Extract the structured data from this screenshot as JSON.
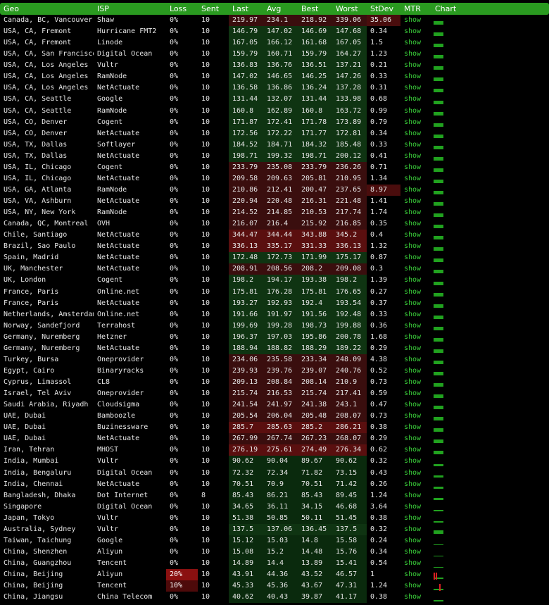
{
  "columns": [
    "Geo",
    "ISP",
    "Loss",
    "Sent",
    "Last",
    "Avg",
    "Best",
    "Worst",
    "StDev",
    "MTR",
    "Chart"
  ],
  "colors": {
    "header": "#2a9a20",
    "accent": "#3ad03a",
    "high": "#5a0f0f",
    "low": "#0f3412"
  },
  "rows": [
    {
      "geo": "Canada, BC, Vancouver",
      "isp": "Shaw",
      "loss": "0%",
      "sent": "10",
      "last": "219.97",
      "avg": "234.1",
      "best": "218.92",
      "worst": "339.06",
      "stdev": "35.06",
      "mtr": "show",
      "lv": "mid",
      "sdw": true,
      "chart": [
        {
          "h": 5
        }
      ]
    },
    {
      "geo": "USA, CA, Fremont",
      "isp": "Hurricane FMT2",
      "loss": "0%",
      "sent": "10",
      "last": "146.79",
      "avg": "147.02",
      "best": "146.69",
      "worst": "147.68",
      "stdev": "0.34",
      "mtr": "show",
      "lv": "low",
      "chart": [
        {
          "h": 5
        }
      ]
    },
    {
      "geo": "USA, CA, Fremont",
      "isp": "Linode",
      "loss": "0%",
      "sent": "10",
      "last": "167.05",
      "avg": "166.12",
      "best": "161.68",
      "worst": "167.05",
      "stdev": "1.5",
      "mtr": "show",
      "lv": "low",
      "chart": [
        {
          "h": 5
        }
      ]
    },
    {
      "geo": "USA, CA, San Francisco",
      "isp": "Digital Ocean",
      "loss": "0%",
      "sent": "10",
      "last": "159.79",
      "avg": "160.71",
      "best": "159.79",
      "worst": "164.27",
      "stdev": "1.23",
      "mtr": "show",
      "lv": "low",
      "chart": [
        {
          "h": 5
        }
      ]
    },
    {
      "geo": "USA, CA, Los Angeles",
      "isp": "Vultr",
      "loss": "0%",
      "sent": "10",
      "last": "136.83",
      "avg": "136.76",
      "best": "136.51",
      "worst": "137.21",
      "stdev": "0.21",
      "mtr": "show",
      "lv": "low",
      "chart": [
        {
          "h": 5
        }
      ]
    },
    {
      "geo": "USA, CA, Los Angeles",
      "isp": "RamNode",
      "loss": "0%",
      "sent": "10",
      "last": "147.02",
      "avg": "146.65",
      "best": "146.25",
      "worst": "147.26",
      "stdev": "0.33",
      "mtr": "show",
      "lv": "low",
      "chart": [
        {
          "h": 5
        }
      ]
    },
    {
      "geo": "USA, CA, Los Angeles",
      "isp": "NetActuate",
      "loss": "0%",
      "sent": "10",
      "last": "136.58",
      "avg": "136.86",
      "best": "136.24",
      "worst": "137.28",
      "stdev": "0.31",
      "mtr": "show",
      "lv": "low",
      "chart": [
        {
          "h": 5
        }
      ]
    },
    {
      "geo": "USA, CA, Seattle",
      "isp": "Google",
      "loss": "0%",
      "sent": "10",
      "last": "131.44",
      "avg": "132.07",
      "best": "131.44",
      "worst": "133.98",
      "stdev": "0.68",
      "mtr": "show",
      "lv": "low",
      "chart": [
        {
          "h": 5
        }
      ]
    },
    {
      "geo": "USA, CA, Seattle",
      "isp": "RamNode",
      "loss": "0%",
      "sent": "10",
      "last": "160.8",
      "avg": "162.89",
      "best": "160.8",
      "worst": "163.72",
      "stdev": "0.99",
      "mtr": "show",
      "lv": "low",
      "chart": [
        {
          "h": 5
        }
      ]
    },
    {
      "geo": "USA, CO, Denver",
      "isp": "Cogent",
      "loss": "0%",
      "sent": "10",
      "last": "171.87",
      "avg": "172.41",
      "best": "171.78",
      "worst": "173.89",
      "stdev": "0.79",
      "mtr": "show",
      "lv": "low",
      "chart": [
        {
          "h": 5
        }
      ]
    },
    {
      "geo": "USA, CO, Denver",
      "isp": "NetActuate",
      "loss": "0%",
      "sent": "10",
      "last": "172.56",
      "avg": "172.22",
      "best": "171.77",
      "worst": "172.81",
      "stdev": "0.34",
      "mtr": "show",
      "lv": "low",
      "chart": [
        {
          "h": 5
        }
      ]
    },
    {
      "geo": "USA, TX, Dallas",
      "isp": "Softlayer",
      "loss": "0%",
      "sent": "10",
      "last": "184.52",
      "avg": "184.71",
      "best": "184.32",
      "worst": "185.48",
      "stdev": "0.33",
      "mtr": "show",
      "lv": "low",
      "chart": [
        {
          "h": 5
        }
      ]
    },
    {
      "geo": "USA, TX, Dallas",
      "isp": "NetActuate",
      "loss": "0%",
      "sent": "10",
      "last": "198.71",
      "avg": "199.32",
      "best": "198.71",
      "worst": "200.12",
      "stdev": "0.41",
      "mtr": "show",
      "lv": "low",
      "chart": [
        {
          "h": 5
        }
      ]
    },
    {
      "geo": "USA, IL, Chicago",
      "isp": "Cogent",
      "loss": "0%",
      "sent": "10",
      "last": "233.79",
      "avg": "235.08",
      "best": "233.79",
      "worst": "236.26",
      "stdev": "0.71",
      "mtr": "show",
      "lv": "mid",
      "chart": [
        {
          "h": 5
        }
      ]
    },
    {
      "geo": "USA, IL, Chicago",
      "isp": "NetActuate",
      "loss": "0%",
      "sent": "10",
      "last": "209.58",
      "avg": "209.63",
      "best": "205.81",
      "worst": "210.95",
      "stdev": "1.34",
      "mtr": "show",
      "lv": "mid",
      "chart": [
        {
          "h": 5
        }
      ]
    },
    {
      "geo": "USA, GA, Atlanta",
      "isp": "RamNode",
      "loss": "0%",
      "sent": "10",
      "last": "210.86",
      "avg": "212.41",
      "best": "200.47",
      "worst": "237.65",
      "stdev": "8.97",
      "mtr": "show",
      "lv": "mid",
      "sdw": true,
      "chart": [
        {
          "h": 5
        }
      ]
    },
    {
      "geo": "USA, VA, Ashburn",
      "isp": "NetActuate",
      "loss": "0%",
      "sent": "10",
      "last": "220.94",
      "avg": "220.48",
      "best": "216.31",
      "worst": "221.48",
      "stdev": "1.41",
      "mtr": "show",
      "lv": "mid",
      "chart": [
        {
          "h": 5
        }
      ]
    },
    {
      "geo": "USA, NY, New York",
      "isp": "RamNode",
      "loss": "0%",
      "sent": "10",
      "last": "214.52",
      "avg": "214.85",
      "best": "210.53",
      "worst": "217.74",
      "stdev": "1.74",
      "mtr": "show",
      "lv": "mid",
      "chart": [
        {
          "h": 5
        }
      ]
    },
    {
      "geo": "Canada, QC, Montreal",
      "isp": "OVH",
      "loss": "0%",
      "sent": "10",
      "last": "216.07",
      "avg": "216.4",
      "best": "215.92",
      "worst": "216.85",
      "stdev": "0.35",
      "mtr": "show",
      "lv": "mid",
      "chart": [
        {
          "h": 5
        }
      ]
    },
    {
      "geo": "Chile, Santiago",
      "isp": "NetActuate",
      "loss": "0%",
      "sent": "10",
      "last": "344.47",
      "avg": "344.44",
      "best": "343.88",
      "worst": "345.2",
      "stdev": "0.4",
      "mtr": "show",
      "lv": "hi",
      "chart": [
        {
          "h": 5
        }
      ]
    },
    {
      "geo": "Brazil, Sao Paulo",
      "isp": "NetActuate",
      "loss": "0%",
      "sent": "10",
      "last": "336.13",
      "avg": "335.17",
      "best": "331.33",
      "worst": "336.13",
      "stdev": "1.32",
      "mtr": "show",
      "lv": "hi",
      "chart": [
        {
          "h": 5
        }
      ]
    },
    {
      "geo": "Spain, Madrid",
      "isp": "NetActuate",
      "loss": "0%",
      "sent": "10",
      "last": "172.48",
      "avg": "172.73",
      "best": "171.99",
      "worst": "175.17",
      "stdev": "0.87",
      "mtr": "show",
      "lv": "low",
      "chart": [
        {
          "h": 5
        }
      ]
    },
    {
      "geo": "UK, Manchester",
      "isp": "NetActuate",
      "loss": "0%",
      "sent": "10",
      "last": "208.91",
      "avg": "208.56",
      "best": "208.2",
      "worst": "209.08",
      "stdev": "0.3",
      "mtr": "show",
      "lv": "mid",
      "chart": [
        {
          "h": 5
        }
      ]
    },
    {
      "geo": "UK, London",
      "isp": "Cogent",
      "loss": "0%",
      "sent": "10",
      "last": "198.2",
      "avg": "194.17",
      "best": "193.38",
      "worst": "198.2",
      "stdev": "1.39",
      "mtr": "show",
      "lv": "low",
      "chart": [
        {
          "h": 5
        }
      ]
    },
    {
      "geo": "France, Paris",
      "isp": "Online.net",
      "loss": "0%",
      "sent": "10",
      "last": "175.81",
      "avg": "176.28",
      "best": "175.81",
      "worst": "176.65",
      "stdev": "0.27",
      "mtr": "show",
      "lv": "low",
      "chart": [
        {
          "h": 5
        }
      ]
    },
    {
      "geo": "France, Paris",
      "isp": "NetActuate",
      "loss": "0%",
      "sent": "10",
      "last": "193.27",
      "avg": "192.93",
      "best": "192.4",
      "worst": "193.54",
      "stdev": "0.37",
      "mtr": "show",
      "lv": "low",
      "chart": [
        {
          "h": 5
        }
      ]
    },
    {
      "geo": "Netherlands, Amsterdam",
      "isp": "Online.net",
      "loss": "0%",
      "sent": "10",
      "last": "191.66",
      "avg": "191.97",
      "best": "191.56",
      "worst": "192.48",
      "stdev": "0.33",
      "mtr": "show",
      "lv": "low",
      "chart": [
        {
          "h": 5
        }
      ]
    },
    {
      "geo": "Norway, Sandefjord",
      "isp": "Terrahost",
      "loss": "0%",
      "sent": "10",
      "last": "199.69",
      "avg": "199.28",
      "best": "198.73",
      "worst": "199.88",
      "stdev": "0.36",
      "mtr": "show",
      "lv": "low",
      "chart": [
        {
          "h": 5
        }
      ]
    },
    {
      "geo": "Germany, Nuremberg",
      "isp": "Hetzner",
      "loss": "0%",
      "sent": "10",
      "last": "196.37",
      "avg": "197.03",
      "best": "195.86",
      "worst": "200.78",
      "stdev": "1.68",
      "mtr": "show",
      "lv": "low",
      "chart": [
        {
          "h": 5
        }
      ]
    },
    {
      "geo": "Germany, Nuremberg",
      "isp": "NetActuate",
      "loss": "0%",
      "sent": "10",
      "last": "188.94",
      "avg": "188.82",
      "best": "188.29",
      "worst": "189.22",
      "stdev": "0.29",
      "mtr": "show",
      "lv": "low",
      "chart": [
        {
          "h": 5
        }
      ]
    },
    {
      "geo": "Turkey, Bursa",
      "isp": "Oneprovider",
      "loss": "0%",
      "sent": "10",
      "last": "234.06",
      "avg": "235.58",
      "best": "233.34",
      "worst": "248.09",
      "stdev": "4.38",
      "mtr": "show",
      "lv": "mid",
      "chart": [
        {
          "h": 5
        }
      ]
    },
    {
      "geo": "Egypt, Cairo",
      "isp": "Binaryracks",
      "loss": "0%",
      "sent": "10",
      "last": "239.93",
      "avg": "239.76",
      "best": "239.07",
      "worst": "240.76",
      "stdev": "0.52",
      "mtr": "show",
      "lv": "mid",
      "chart": [
        {
          "h": 5
        }
      ]
    },
    {
      "geo": "Cyprus, Limassol",
      "isp": "CL8",
      "loss": "0%",
      "sent": "10",
      "last": "209.13",
      "avg": "208.84",
      "best": "208.14",
      "worst": "210.9",
      "stdev": "0.73",
      "mtr": "show",
      "lv": "mid",
      "chart": [
        {
          "h": 5
        }
      ]
    },
    {
      "geo": "Israel, Tel Aviv",
      "isp": "Oneprovider",
      "loss": "0%",
      "sent": "10",
      "last": "215.74",
      "avg": "216.53",
      "best": "215.74",
      "worst": "217.41",
      "stdev": "0.59",
      "mtr": "show",
      "lv": "mid",
      "chart": [
        {
          "h": 5
        }
      ]
    },
    {
      "geo": "Saudi Arabia, Riyadh",
      "isp": "Cloudsigma",
      "loss": "0%",
      "sent": "10",
      "last": "241.54",
      "avg": "241.97",
      "best": "241.38",
      "worst": "243.1",
      "stdev": "0.47",
      "mtr": "show",
      "lv": "mid",
      "chart": [
        {
          "h": 5
        }
      ]
    },
    {
      "geo": "UAE, Dubai",
      "isp": "Bamboozle",
      "loss": "0%",
      "sent": "10",
      "last": "205.54",
      "avg": "206.04",
      "best": "205.48",
      "worst": "208.07",
      "stdev": "0.73",
      "mtr": "show",
      "lv": "mid",
      "chart": [
        {
          "h": 5
        }
      ]
    },
    {
      "geo": "UAE, Dubai",
      "isp": "Buzinessware",
      "loss": "0%",
      "sent": "10",
      "last": "285.7",
      "avg": "285.63",
      "best": "285.2",
      "worst": "286.21",
      "stdev": "0.38",
      "mtr": "show",
      "lv": "hi",
      "chart": [
        {
          "h": 5
        }
      ]
    },
    {
      "geo": "UAE, Dubai",
      "isp": "NetActuate",
      "loss": "0%",
      "sent": "10",
      "last": "267.99",
      "avg": "267.74",
      "best": "267.23",
      "worst": "268.07",
      "stdev": "0.29",
      "mtr": "show",
      "lv": "mid",
      "chart": [
        {
          "h": 5
        }
      ]
    },
    {
      "geo": "Iran, Tehran",
      "isp": "MHOST",
      "loss": "0%",
      "sent": "10",
      "last": "276.19",
      "avg": "275.61",
      "best": "274.49",
      "worst": "276.34",
      "stdev": "0.62",
      "mtr": "show",
      "lv": "hi",
      "chart": [
        {
          "h": 5
        }
      ]
    },
    {
      "geo": "India, Mumbai",
      "isp": "Vultr",
      "loss": "0%",
      "sent": "10",
      "last": "90.62",
      "avg": "90.04",
      "best": "89.67",
      "worst": "90.62",
      "stdev": "0.32",
      "mtr": "show",
      "lv": "vlow",
      "chart": [
        {
          "h": 3
        }
      ]
    },
    {
      "geo": "India, Bengaluru",
      "isp": "Digital Ocean",
      "loss": "0%",
      "sent": "10",
      "last": "72.32",
      "avg": "72.34",
      "best": "71.82",
      "worst": "73.15",
      "stdev": "0.43",
      "mtr": "show",
      "lv": "vlow",
      "chart": [
        {
          "h": 3
        }
      ]
    },
    {
      "geo": "India, Chennai",
      "isp": "NetActuate",
      "loss": "0%",
      "sent": "10",
      "last": "70.51",
      "avg": "70.9",
      "best": "70.51",
      "worst": "71.42",
      "stdev": "0.26",
      "mtr": "show",
      "lv": "vlow",
      "chart": [
        {
          "h": 3
        }
      ]
    },
    {
      "geo": "Bangladesh, Dhaka",
      "isp": "Dot Internet",
      "loss": "0%",
      "sent": "8",
      "last": "85.43",
      "avg": "86.21",
      "best": "85.43",
      "worst": "89.45",
      "stdev": "1.24",
      "mtr": "show",
      "lv": "vlow",
      "chart": [
        {
          "h": 3
        }
      ]
    },
    {
      "geo": "Singapore",
      "isp": "Digital Ocean",
      "loss": "0%",
      "sent": "10",
      "last": "34.65",
      "avg": "36.11",
      "best": "34.15",
      "worst": "46.68",
      "stdev": "3.64",
      "mtr": "show",
      "lv": "vlow",
      "chart": [
        {
          "h": 2
        }
      ]
    },
    {
      "geo": "Japan, Tokyo",
      "isp": "Vultr",
      "loss": "0%",
      "sent": "10",
      "last": "51.38",
      "avg": "50.85",
      "best": "50.11",
      "worst": "51.45",
      "stdev": "0.38",
      "mtr": "show",
      "lv": "vlow",
      "chart": [
        {
          "h": 2
        }
      ]
    },
    {
      "geo": "Australia, Sydney",
      "isp": "Vultr",
      "loss": "0%",
      "sent": "10",
      "last": "137.5",
      "avg": "137.06",
      "best": "136.45",
      "worst": "137.5",
      "stdev": "0.32",
      "mtr": "show",
      "lv": "low",
      "chart": [
        {
          "h": 5
        }
      ]
    },
    {
      "geo": "Taiwan, Taichung",
      "isp": "Google",
      "loss": "0%",
      "sent": "10",
      "last": "15.12",
      "avg": "15.03",
      "best": "14.8",
      "worst": "15.58",
      "stdev": "0.24",
      "mtr": "show",
      "lv": "vlow",
      "chart": [
        {
          "h": 1
        }
      ]
    },
    {
      "geo": "China, Shenzhen",
      "isp": "Aliyun",
      "loss": "0%",
      "sent": "10",
      "last": "15.08",
      "avg": "15.2",
      "best": "14.48",
      "worst": "15.76",
      "stdev": "0.34",
      "mtr": "show",
      "lv": "vlow",
      "chart": [
        {
          "h": 1
        }
      ]
    },
    {
      "geo": "China, Guangzhou",
      "isp": "Tencent",
      "loss": "0%",
      "sent": "10",
      "last": "14.89",
      "avg": "14.4",
      "best": "13.89",
      "worst": "15.41",
      "stdev": "0.54",
      "mtr": "show",
      "lv": "vlow",
      "chart": [
        {
          "h": 1
        }
      ]
    },
    {
      "geo": "China, Beijing",
      "isp": "Aliyun",
      "loss": "20%",
      "sent": "10",
      "last": "43.91",
      "avg": "44.36",
      "best": "43.52",
      "worst": "46.57",
      "stdev": "1",
      "mtr": "show",
      "lv": "vlow",
      "lossLv": "hi",
      "chart": [
        {
          "h": 2
        },
        {
          "spike": 10,
          "x": 0
        },
        {
          "spike": 10,
          "x": 3
        }
      ]
    },
    {
      "geo": "China, Beijing",
      "isp": "Tencent",
      "loss": "10%",
      "sent": "10",
      "last": "45.33",
      "avg": "45.36",
      "best": "43.67",
      "worst": "47.31",
      "stdev": "1.24",
      "mtr": "show",
      "lv": "vlow",
      "lossLv": "mid",
      "chart": [
        {
          "h": 2
        },
        {
          "spike": 10,
          "x": 8
        }
      ]
    },
    {
      "geo": "China, Jiangsu",
      "isp": "China Telecom",
      "loss": "0%",
      "sent": "10",
      "last": "40.62",
      "avg": "40.43",
      "best": "39.87",
      "worst": "41.17",
      "stdev": "0.38",
      "mtr": "show",
      "lv": "vlow",
      "chart": [
        {
          "h": 2
        }
      ]
    }
  ]
}
